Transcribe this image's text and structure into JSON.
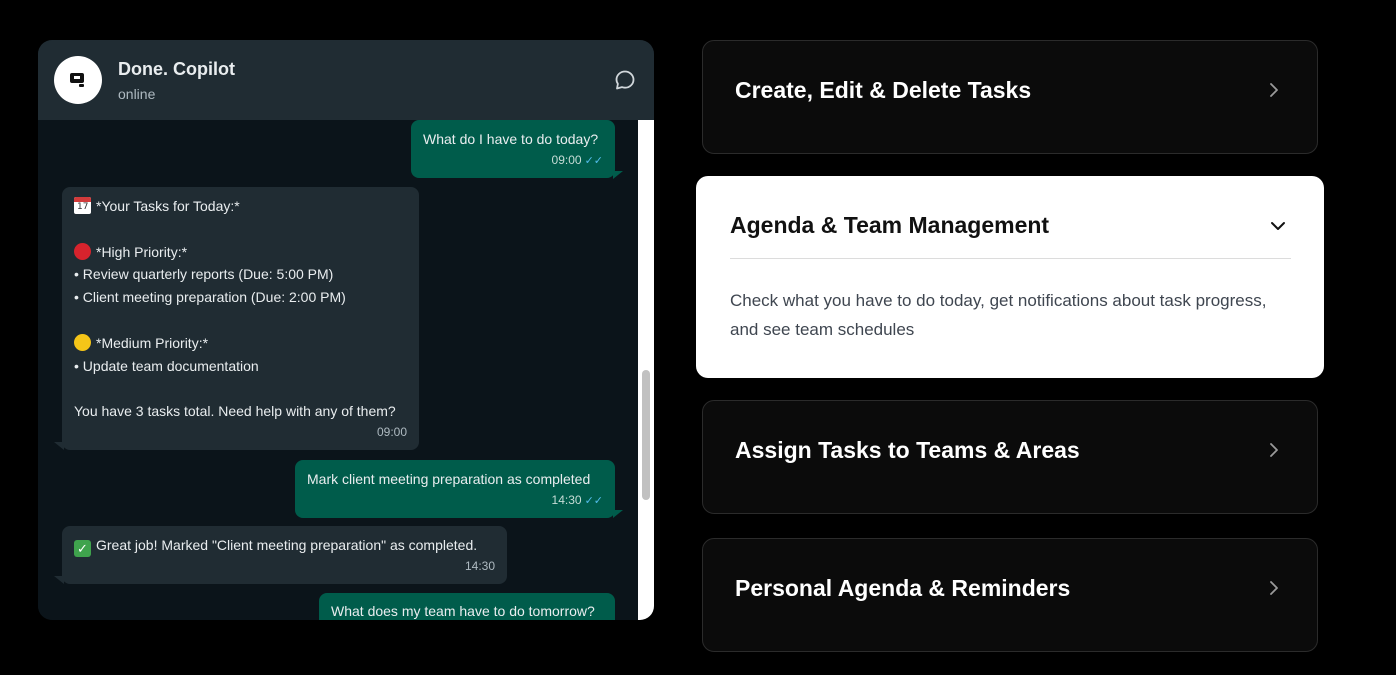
{
  "chat": {
    "contact_name": "Done. Copilot",
    "contact_status": "online",
    "messages": [
      {
        "direction": "out",
        "lines": [
          "What do I have to do today?"
        ],
        "time": "09:00",
        "read": true
      },
      {
        "direction": "in",
        "lines": [
          "*Your Tasks for Today:*",
          "",
          "*High Priority:*",
          "• Review quarterly reports (Due: 5:00 PM)",
          "• Client meeting preparation (Due: 2:00 PM)",
          "",
          "*Medium Priority:*",
          "• Update team documentation",
          "",
          "You have 3 tasks total. Need help with any of them?"
        ],
        "time": "09:00"
      },
      {
        "direction": "out",
        "lines": [
          "Mark client meeting preparation as completed"
        ],
        "time": "14:30",
        "read": true
      },
      {
        "direction": "in",
        "lines": [
          "Great job! Marked \"Client meeting preparation\" as completed."
        ],
        "time": "14:30"
      },
      {
        "direction": "out",
        "lines": [
          "What does my team have to do tomorrow?"
        ],
        "time": ""
      }
    ],
    "icons": {
      "calendar": "calendar-icon",
      "high_priority": "red-circle-icon",
      "medium_priority": "yellow-circle-icon",
      "completed": "check-mark-icon"
    }
  },
  "features": [
    {
      "title": "Create, Edit & Delete Tasks",
      "expanded": false
    },
    {
      "title": "Agenda & Team Management",
      "expanded": true,
      "description": "Check what you have to do today, get notifications about task progress, and see team schedules"
    },
    {
      "title": "Assign Tasks to Teams & Areas",
      "expanded": false
    },
    {
      "title": "Personal Agenda & Reminders",
      "expanded": false
    }
  ],
  "colors": {
    "page_background": "#000000",
    "chat_header": "#202c33",
    "chat_background": "#0b141a",
    "outgoing_bubble": "#005c4b",
    "incoming_bubble": "#202c33",
    "read_tick": "#53bdeb",
    "high_priority": "#d7232d",
    "medium_priority": "#f5c518"
  }
}
